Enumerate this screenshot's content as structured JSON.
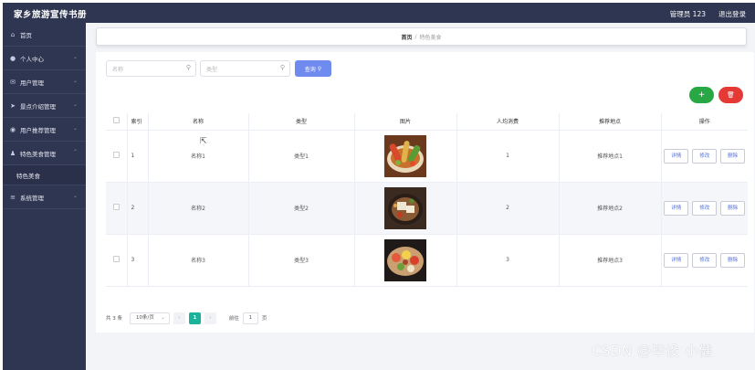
{
  "app": {
    "title": "家乡旅游宣传书册"
  },
  "header": {
    "user": "管理员 123",
    "logout": "退出登录"
  },
  "sidebar": {
    "items": [
      {
        "label": "首页",
        "icon": "home-icon"
      },
      {
        "label": "个人中心",
        "icon": "user-icon",
        "expandable": true
      },
      {
        "label": "用户管理",
        "icon": "mail-icon",
        "expandable": true
      },
      {
        "label": "景点介绍管理",
        "icon": "send-icon",
        "expandable": true
      },
      {
        "label": "用户推荐管理",
        "icon": "pin-icon",
        "expandable": true
      },
      {
        "label": "特色美食管理",
        "icon": "person-icon",
        "expandable": true,
        "expanded": true
      },
      {
        "label": "系统管理",
        "icon": "menu-icon",
        "expandable": true
      }
    ],
    "sub_items": [
      {
        "label": "特色美食",
        "parent": "特色美食管理"
      }
    ]
  },
  "breadcrumb": {
    "home": "首页",
    "separator": "/",
    "current": "特色美食"
  },
  "search": {
    "name_placeholder": "名称",
    "type_placeholder": "类型",
    "query_button": "查询"
  },
  "actions": {
    "add": "+",
    "delete": "🗑"
  },
  "table": {
    "headers": [
      "索引",
      "名称",
      "类型",
      "图片",
      "人均消费",
      "推荐地点",
      "操作"
    ],
    "rows": [
      {
        "index": "1",
        "name": "名称1",
        "type": "类型1",
        "price": "1",
        "location": "推荐地点1"
      },
      {
        "index": "2",
        "name": "名称2",
        "type": "类型2",
        "price": "2",
        "location": "推荐地点2"
      },
      {
        "index": "3",
        "name": "名称3",
        "type": "类型3",
        "price": "3",
        "location": "推荐地点3"
      }
    ],
    "row_actions": {
      "detail": "详情",
      "edit": "修改",
      "delete": "删除"
    }
  },
  "pagination": {
    "total": "共 3 条",
    "page_size": "10条/页",
    "current_page": "1",
    "goto_label": "前往",
    "goto_value": "1",
    "page_suffix": "页"
  },
  "watermark": "CSDN @毕设 小健",
  "colors": {
    "sidebar": "#2f3651",
    "primary": "#6f8bf0",
    "success": "#28a745",
    "danger": "#e53935",
    "page_active": "#19b49a"
  }
}
